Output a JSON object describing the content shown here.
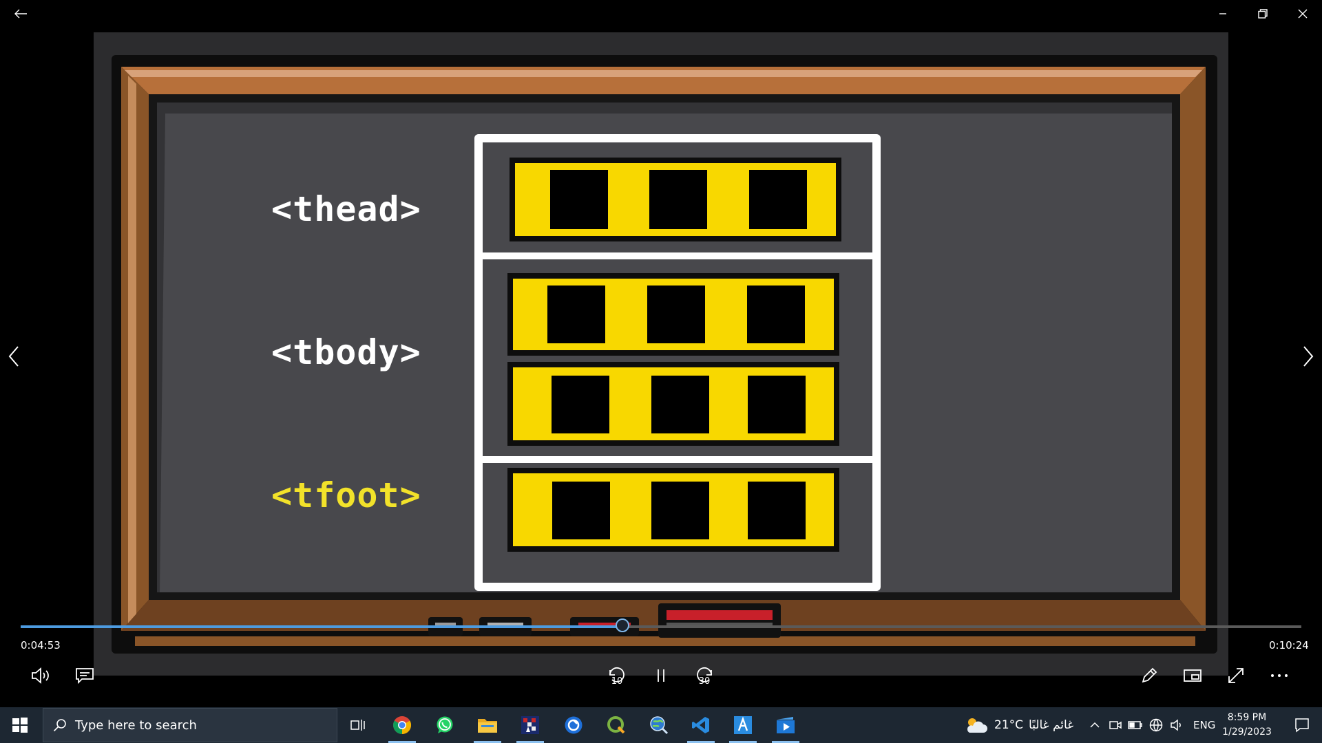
{
  "video": {
    "labels": {
      "thead": "<thead>",
      "tbody": "<tbody>",
      "tfoot": "<tfoot>"
    },
    "colors": {
      "thead_label": "#ffffff",
      "tbody_label": "#ffffff",
      "tfoot_label": "#f2e22a",
      "row_fill": "#f8d800",
      "board": "#4a4a4e",
      "wood": "#8a5528"
    }
  },
  "player": {
    "time_elapsed": "0:04:53",
    "time_total": "0:10:24",
    "progress_fraction": 0.47,
    "skip_back_label": "10",
    "skip_forward_label": "30",
    "accent_color": "#4d9be0"
  },
  "window": {
    "back_icon": "back-arrow-icon",
    "controls": [
      "minimize-icon",
      "restore-icon",
      "close-icon"
    ]
  },
  "taskbar": {
    "search_placeholder": "Type here to search",
    "apps": [
      {
        "name": "task-view-icon",
        "active": false
      },
      {
        "name": "chrome-icon",
        "active": true
      },
      {
        "name": "whatsapp-icon",
        "active": false
      },
      {
        "name": "file-explorer-icon",
        "active": true
      },
      {
        "name": "chess-app-icon",
        "active": true
      },
      {
        "name": "browser-app-icon",
        "active": false
      },
      {
        "name": "qgis-icon",
        "active": false
      },
      {
        "name": "globe-search-icon",
        "active": false
      },
      {
        "name": "vscode-icon",
        "active": true
      },
      {
        "name": "font-app-icon",
        "active": true
      },
      {
        "name": "media-player-icon",
        "active": true
      }
    ],
    "weather": {
      "temp": "21°C",
      "condition": "غائم غالبًا"
    },
    "language": "ENG",
    "time": "8:59 PM",
    "date": "1/29/2023"
  }
}
